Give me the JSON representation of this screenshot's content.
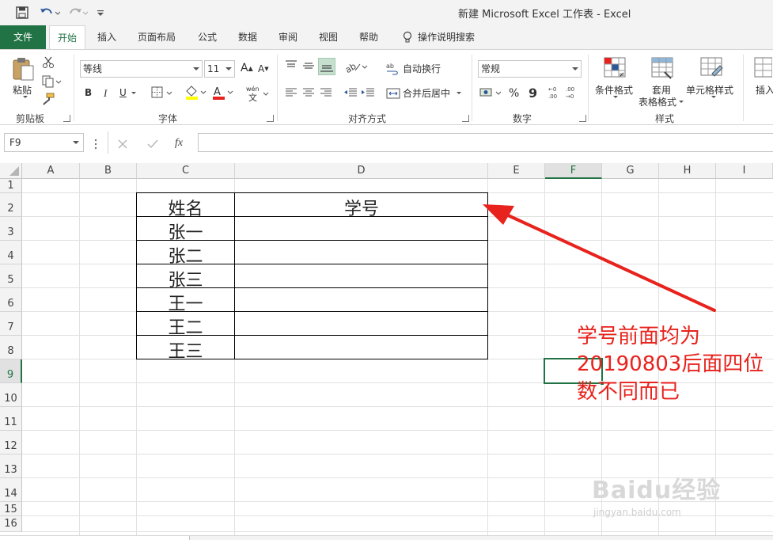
{
  "window": {
    "title": "新建 Microsoft Excel 工作表  -  Excel"
  },
  "tabs": [
    {
      "label": "文件"
    },
    {
      "label": "开始"
    },
    {
      "label": "插入"
    },
    {
      "label": "页面布局"
    },
    {
      "label": "公式"
    },
    {
      "label": "数据"
    },
    {
      "label": "审阅"
    },
    {
      "label": "视图"
    },
    {
      "label": "帮助"
    },
    {
      "label": "操作说明搜索"
    }
  ],
  "ribbon": {
    "clipboard": {
      "paste": "粘贴",
      "label": "剪贴板"
    },
    "font": {
      "name": "等线",
      "size": "11",
      "grow": "A",
      "shrink": "A",
      "bold": "B",
      "italic": "I",
      "underline": "U",
      "label": "字体"
    },
    "alignment": {
      "wrap": "自动换行",
      "merge": "合并后居中",
      "label": "对齐方式"
    },
    "number": {
      "format": "常规",
      "percent": "%",
      "comma": "9",
      "label": "数字"
    },
    "styles": {
      "conditional": "条件格式",
      "table_line1": "套用",
      "table_line2": "表格格式",
      "cell": "单元格样式",
      "label": "样式"
    },
    "cells": {
      "insert": "插入"
    }
  },
  "formula_bar": {
    "name_box": "F9",
    "fx": "fx",
    "value": ""
  },
  "columns": [
    "A",
    "B",
    "C",
    "D",
    "E",
    "F",
    "G",
    "H",
    "I"
  ],
  "rows": [
    "1",
    "2",
    "3",
    "4",
    "5",
    "6",
    "7",
    "8",
    "9",
    "10",
    "11",
    "12",
    "13",
    "14",
    "15",
    "16"
  ],
  "selected": {
    "column": "F",
    "row": "9"
  },
  "table": {
    "headers": [
      "姓名",
      "学号"
    ],
    "names": [
      "张一",
      "张二",
      "张三",
      "王一",
      "王二",
      "王三"
    ]
  },
  "annotation": {
    "lines": [
      "学号前面均为",
      "20190803后面四位",
      "数不同而已"
    ],
    "color": "#e8221c"
  },
  "watermark": {
    "brand": "Baidu经验",
    "url": "jingyan.baidu.com"
  },
  "colors": {
    "excel_green": "#217346",
    "arrow_red": "#e8221c"
  }
}
